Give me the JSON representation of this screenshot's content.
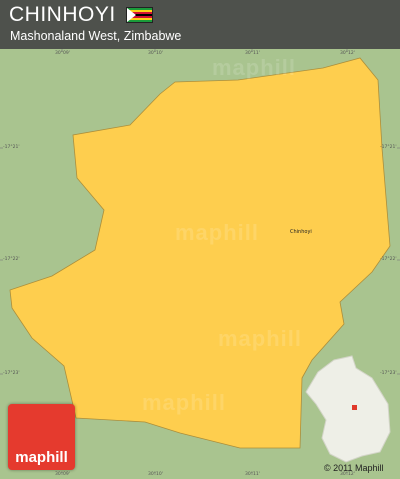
{
  "header": {
    "title": "CHINHOYI",
    "subtitle": "Mashonaland West, Zimbabwe"
  },
  "colors": {
    "background": "#a9c48f",
    "district_fill": "#fece4e",
    "header_bg": "#464646",
    "logo_red": "#e53a2e",
    "inset_fill": "#f2f2ec",
    "location_marker": "#e0392a"
  },
  "flag": {
    "icon": "zimbabwe-flag-icon",
    "stripes": [
      "#1a9b3a",
      "#fcd116",
      "#d21034",
      "#000000",
      "#d21034",
      "#fcd116",
      "#1a9b3a"
    ]
  },
  "labels": {
    "town": "Chinhoyi"
  },
  "ticks": {
    "top": [
      "30°09'",
      "30°10'",
      "30°11'",
      "30°12'"
    ],
    "bottom": [
      "30°09'",
      "30°10'",
      "30°11'",
      "30°12'"
    ],
    "left": [
      "-17°21'",
      "-17°22'",
      "-17°23'",
      "-17°24'"
    ],
    "right": [
      "-17°21'",
      "-17°22'",
      "-17°23'",
      "-17°24'"
    ]
  },
  "watermark": "maphill",
  "logo": {
    "text": "maphill"
  },
  "copyright": "© 2011 Maphill"
}
